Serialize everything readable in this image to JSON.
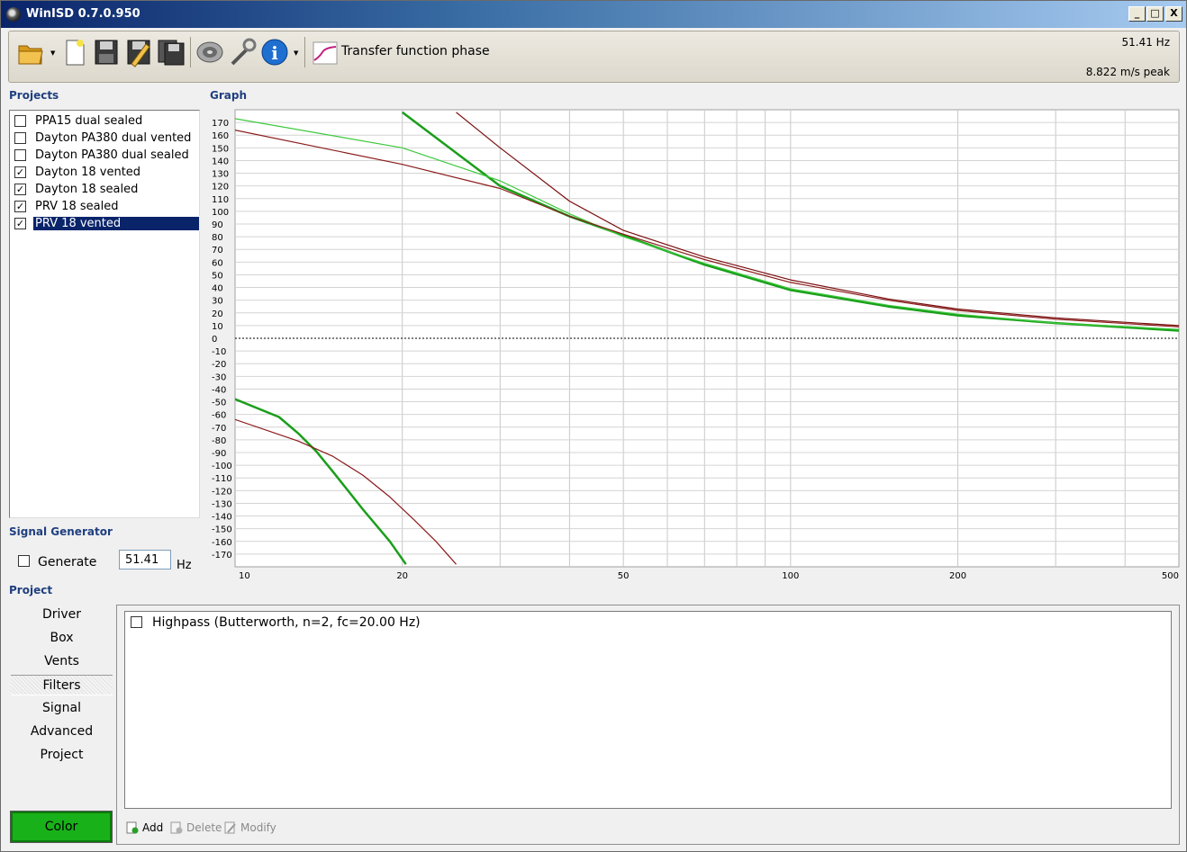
{
  "window": {
    "title": "WinISD 0.7.0.950",
    "min_glyph": "_",
    "max_glyph": "□",
    "close_glyph": "X"
  },
  "toolbar": {
    "mode_label": "Transfer function phase",
    "frequency_readout": "51.41 Hz",
    "excursion_readout": "8.822 m/s peak",
    "buttons": [
      "open-icon",
      "new-icon",
      "save-icon",
      "save-as-icon",
      "save-all-icon",
      "driver-icon",
      "tools-icon",
      "info-icon",
      "graph-type-icon"
    ]
  },
  "projects": {
    "label": "Projects",
    "items": [
      {
        "label": "PPA15 dual sealed",
        "checked": false
      },
      {
        "label": "Dayton PA380 dual vented",
        "checked": false
      },
      {
        "label": "Dayton PA380 dual sealed",
        "checked": false
      },
      {
        "label": "Dayton 18 vented",
        "checked": true
      },
      {
        "label": "Dayton 18 sealed",
        "checked": true
      },
      {
        "label": "PRV 18 sealed",
        "checked": true
      },
      {
        "label": "PRV 18 vented",
        "checked": true,
        "selected": true
      }
    ]
  },
  "signal_generator": {
    "label": "Signal Generator",
    "generate_label": "Generate",
    "frequency": "51.41",
    "unit": "Hz",
    "checked": false
  },
  "graph": {
    "label": "Graph"
  },
  "project_section": {
    "label": "Project",
    "nav": [
      "Driver",
      "Box",
      "Vents",
      "Filters",
      "Signal",
      "Advanced",
      "Project"
    ],
    "active": "Filters",
    "color_button": "Color",
    "color": "#19b119"
  },
  "filters": {
    "items": [
      {
        "label": "Highpass (Butterworth, n=2, fc=20.00 Hz)",
        "checked": false
      }
    ],
    "add_label": "Add",
    "delete_label": "Delete",
    "modify_label": "Modify"
  },
  "chart_data": {
    "type": "line",
    "title": "",
    "xlabel": "",
    "ylabel": "",
    "xscale": "log",
    "xlim": [
      10,
      500
    ],
    "ylim": [
      -180,
      180
    ],
    "x_ticks": [
      10,
      20,
      50,
      100,
      200,
      500
    ],
    "y_ticks": [
      170,
      160,
      150,
      140,
      130,
      120,
      110,
      100,
      90,
      80,
      70,
      60,
      50,
      40,
      30,
      20,
      10,
      0,
      -10,
      -20,
      -30,
      -40,
      -50,
      -60,
      -70,
      -80,
      -90,
      -100,
      -110,
      -120,
      -130,
      -140,
      -150,
      -160,
      -170
    ],
    "grid": true,
    "zero_line": "dashed",
    "series": [
      {
        "color": "#1a9e1a",
        "width": 2.5,
        "segments": [
          {
            "x": [
              20,
              30,
              40,
              50,
              70,
              100,
              150,
              200,
              300,
              500
            ],
            "y": [
              178,
              120,
              96,
              81,
              58,
              38,
              25,
              18,
              12,
              6
            ]
          },
          {
            "x": [
              10,
              12,
              13,
              14,
              15,
              17,
              19,
              20.3
            ],
            "y": [
              -48,
              -62,
              -75,
              -89,
              -105,
              -135,
              -160,
              -178
            ]
          }
        ]
      },
      {
        "color": "#3cc83c",
        "width": 1.2,
        "segments": [
          {
            "x": [
              10,
              20,
              30,
              40,
              50,
              70,
              100,
              150,
              200,
              300,
              500
            ],
            "y": [
              173,
              150,
              124,
              98,
              80,
              59,
              39,
              26,
              19,
              12,
              7
            ]
          }
        ]
      },
      {
        "color": "#8b1a1a",
        "width": 1.2,
        "segments": [
          {
            "x": [
              10,
              20,
              30,
              40,
              50,
              70,
              100,
              150,
              200,
              300,
              500
            ],
            "y": [
              164,
              137,
              118,
              96,
              82,
              62,
              44,
              30,
              22,
              15,
              9
            ]
          },
          {
            "x": [
              10,
              13,
              15,
              17,
              19,
              21,
              23,
              25
            ],
            "y": [
              -64,
              -81,
              -93,
              -108,
              -125,
              -143,
              -160,
              -178
            ]
          }
        ]
      },
      {
        "color": "#7a0f0f",
        "width": 1.2,
        "segments": [
          {
            "x": [
              25,
              30,
              40,
              50,
              70,
              100,
              150,
              200,
              300,
              500
            ],
            "y": [
              178,
              150,
              108,
              85,
              64,
              46,
              31,
              23,
              16,
              10
            ]
          }
        ]
      }
    ]
  }
}
